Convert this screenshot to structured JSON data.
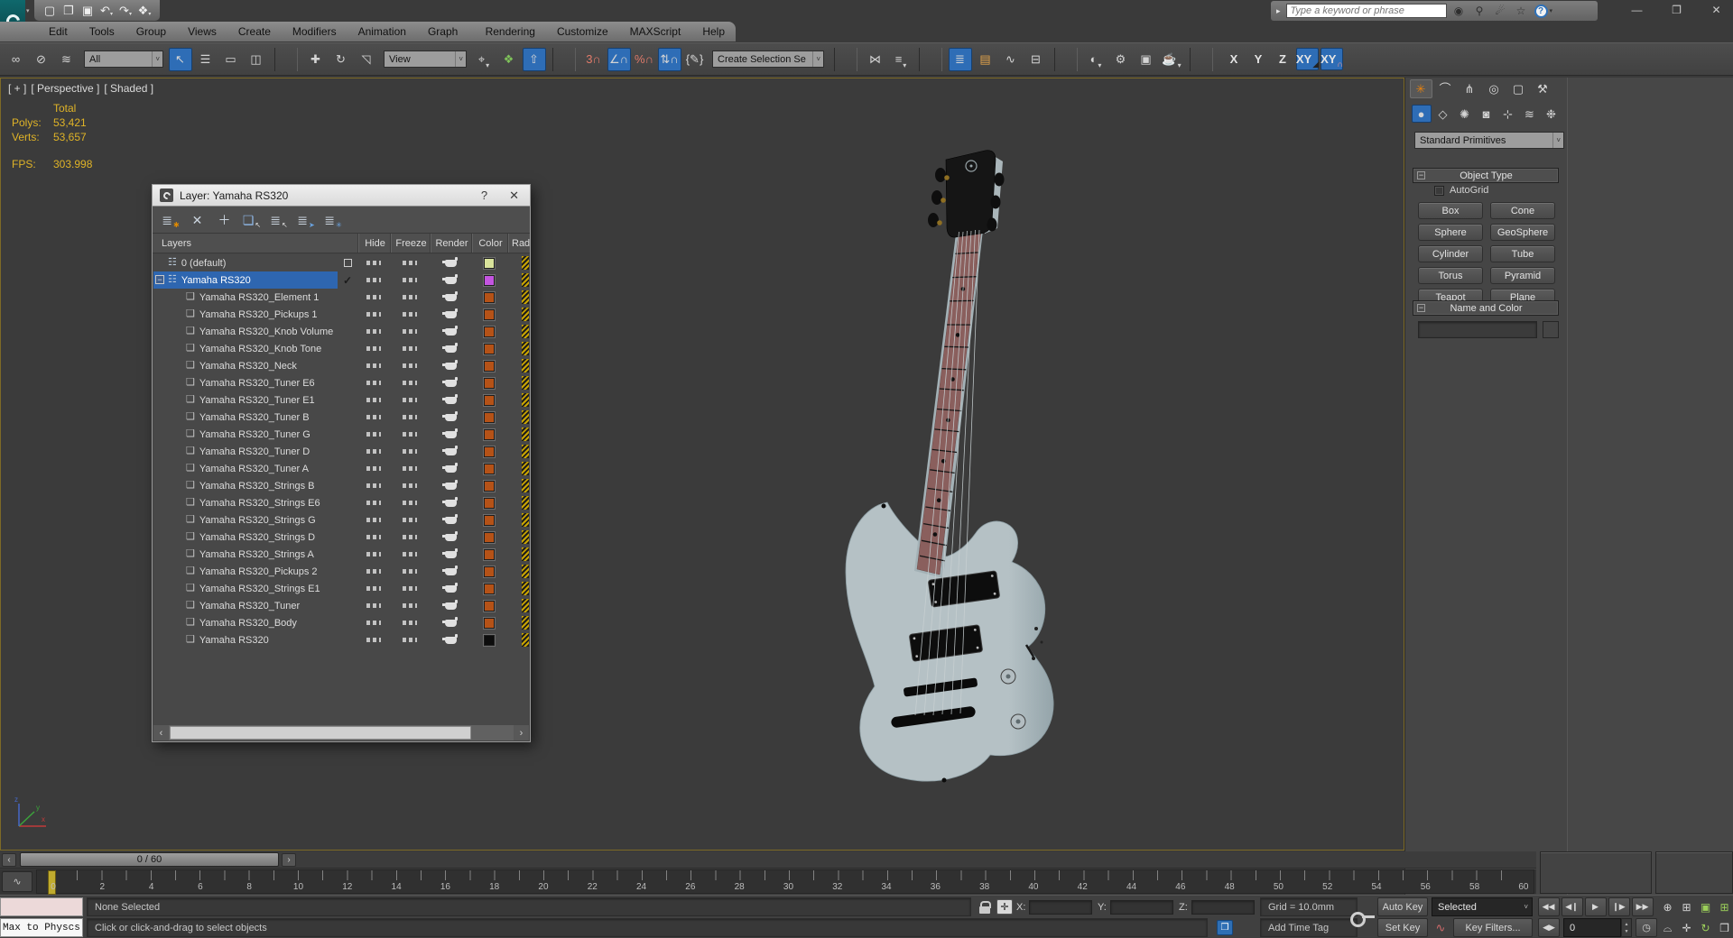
{
  "window": {
    "search_placeholder": "Type a keyword or phrase",
    "workspace_arrow": "▸",
    "qat": [
      {
        "g": "▢",
        "n": "new-scene-icon"
      },
      {
        "g": "❐",
        "n": "open-file-icon"
      },
      {
        "g": "▣",
        "n": "save-file-icon"
      },
      {
        "g": "↶",
        "n": "undo-icon",
        "drop": "▾"
      },
      {
        "g": "↷",
        "n": "redo-icon",
        "drop": "▾"
      },
      {
        "g": "❖",
        "n": "project-folder-icon",
        "drop": "▾"
      }
    ],
    "search_icons": [
      {
        "g": "◉",
        "n": "search-icon"
      },
      {
        "g": "⚲",
        "n": "sign-in-icon"
      },
      {
        "g": "☄",
        "n": "communication-center-icon"
      },
      {
        "g": "☆",
        "n": "favorites-icon"
      }
    ],
    "help_glyph": "?",
    "help_drop": "▾",
    "window_controls": [
      {
        "g": "—",
        "n": "minimize-button"
      },
      {
        "g": "❐",
        "n": "restore-button"
      },
      {
        "g": "✕",
        "n": "close-button"
      }
    ]
  },
  "menus": [
    "Edit",
    "Tools",
    "Group",
    "Views",
    "Create",
    "Modifiers",
    "Animation",
    "Graph Editors",
    "Rendering",
    "Customize",
    "MAXScript",
    "Help"
  ],
  "toolbar": {
    "seg_a": [
      {
        "g": "∞",
        "n": "select-and-link-icon"
      },
      {
        "g": "⊘",
        "n": "unlink-selection-icon"
      },
      {
        "g": "≋",
        "n": "bind-to-space-warp-icon"
      }
    ],
    "filter_dropdown": "All",
    "seg_b": [
      {
        "g": "↖",
        "n": "select-object-icon",
        "cls": "on"
      },
      {
        "g": "☰",
        "n": "select-by-name-icon"
      },
      {
        "g": "▭",
        "n": "rectangular-selection-region-icon"
      },
      {
        "g": "◫",
        "n": "window-crossing-icon"
      },
      {
        "cls": "sep",
        "n": "separator"
      },
      {
        "g": "✚",
        "n": "select-and-move-icon"
      },
      {
        "g": "↻",
        "n": "select-and-rotate-icon"
      },
      {
        "g": "◹",
        "n": "select-and-scale-icon"
      }
    ],
    "coord_dropdown": "View",
    "seg_c": [
      {
        "g": "⌖",
        "n": "use-pivot-point-center-icon",
        "drop": "▾"
      },
      {
        "g": "❖",
        "n": "select-and-manipulate-icon",
        "gc": "#7fc35a"
      },
      {
        "g": "⇧",
        "n": "keyboard-shortcut-override-icon",
        "cls": "on"
      },
      {
        "cls": "sep",
        "n": "separator"
      },
      {
        "g": "3∩",
        "n": "snaps-toggle-icon",
        "gc": "#e07a6a"
      },
      {
        "g": "∠∩",
        "n": "angle-snap-toggle-icon",
        "cls": "on"
      },
      {
        "g": "%∩",
        "n": "percent-snap-toggle-icon",
        "gc": "#e07a6a"
      },
      {
        "g": "⇅∩",
        "n": "spinner-snap-toggle-icon",
        "cls": "on"
      },
      {
        "g": "{✎}",
        "n": "edit-named-selection-sets-icon"
      }
    ],
    "selset_dropdown": "Create Selection Se",
    "seg_d": [
      {
        "cls": "sep",
        "n": "separator"
      },
      {
        "g": "⋈",
        "n": "mirror-icon"
      },
      {
        "g": "≡",
        "n": "align-icon",
        "drop": "▾"
      },
      {
        "cls": "sep",
        "n": "separator"
      },
      {
        "g": "≣",
        "n": "layer-manager-icon",
        "cls": "on"
      },
      {
        "g": "▤",
        "n": "scene-explorer-icon",
        "gc": "#e0a24a"
      },
      {
        "g": "∿",
        "n": "curve-editor-icon"
      },
      {
        "g": "⊟",
        "n": "schematic-view-icon"
      },
      {
        "cls": "sep",
        "n": "separator"
      },
      {
        "g": "◐",
        "n": "material-editor-icon",
        "drop": "▾"
      },
      {
        "g": "⚙",
        "n": "render-setup-icon"
      },
      {
        "g": "▣",
        "n": "rendered-frame-window-icon"
      },
      {
        "g": "☕",
        "n": "render-production-icon",
        "drop": "▾"
      },
      {
        "cls": "sep",
        "n": "separator"
      }
    ],
    "axis": [
      {
        "g": "X",
        "n": "restrict-x-button"
      },
      {
        "g": "Y",
        "n": "restrict-y-button"
      },
      {
        "g": "Z",
        "n": "restrict-z-button"
      },
      {
        "g": "XY",
        "n": "restrict-xy-plane-button",
        "cls": "on",
        "drop": "◢",
        "dc": "#222222"
      },
      {
        "g": "XY",
        "n": "snap-axis-constraint-button",
        "cls": "on",
        "drop": "∩",
        "dc": "#ff9a8a"
      }
    ]
  },
  "viewport": {
    "menu_general": "[ + ]",
    "menu_pov": "[ Perspective ]",
    "menu_shading": "[ Shaded ]",
    "stats": {
      "header": "Total",
      "polys_label": "Polys:",
      "polys": "53,421",
      "verts_label": "Verts:",
      "verts": "53,657",
      "fps_label": "FPS:",
      "fps": "303.998"
    }
  },
  "layer_dialog": {
    "title": "Layer: Yamaha RS320",
    "help_button": "?",
    "close_button": "✕",
    "toolbar": [
      {
        "g": "≣",
        "n": "create-new-layer-icon",
        "drop": "✱",
        "dc": "#e08a00"
      },
      {
        "g": "✕",
        "n": "delete-empty-layers-icon"
      },
      {
        "g": "＋",
        "n": "add-selection-to-layer-icon"
      },
      {
        "g": "❏",
        "n": "select-objects-in-layer-icon",
        "gc": "#8fb8e8",
        "drop": "↖",
        "dc": "#e6e6e6"
      },
      {
        "g": "≣",
        "n": "highlight-selected-objects-layers-icon",
        "drop": "↖",
        "dc": "#e6e6e6"
      },
      {
        "g": "≣",
        "n": "select-highlighted-layers-icon",
        "drop": "➤",
        "dc": "#6aa3e0"
      },
      {
        "g": "≣",
        "n": "set-current-layer-icon",
        "drop": "✳",
        "dc": "#6aa3e0"
      }
    ],
    "columns": [
      "Layers",
      "Hide",
      "Freeze",
      "Render",
      "Color",
      "Rad"
    ],
    "rows": [
      {
        "label": "0 (default)",
        "icon": "lyr",
        "color": "#d9e39b",
        "cls": "def"
      },
      {
        "label": "Yamaha RS320",
        "icon": "lyr",
        "color": "#c455e0",
        "cls": "sel"
      },
      {
        "label": "Yamaha RS320_Element 1",
        "icon": "obj",
        "color": "#b55217",
        "cls": "child"
      },
      {
        "label": "Yamaha RS320_Pickups 1",
        "icon": "obj",
        "color": "#b55217",
        "cls": "child"
      },
      {
        "label": "Yamaha RS320_Knob Volume",
        "icon": "obj",
        "color": "#b55217",
        "cls": "child"
      },
      {
        "label": "Yamaha RS320_Knob Tone",
        "icon": "obj",
        "color": "#b55217",
        "cls": "child"
      },
      {
        "label": "Yamaha RS320_Neck",
        "icon": "obj",
        "color": "#b55217",
        "cls": "child"
      },
      {
        "label": "Yamaha RS320_Tuner E6",
        "icon": "obj",
        "color": "#b55217",
        "cls": "child"
      },
      {
        "label": "Yamaha RS320_Tuner E1",
        "icon": "obj",
        "color": "#b55217",
        "cls": "child"
      },
      {
        "label": "Yamaha RS320_Tuner B",
        "icon": "obj",
        "color": "#b55217",
        "cls": "child"
      },
      {
        "label": "Yamaha RS320_Tuner G",
        "icon": "obj",
        "color": "#b55217",
        "cls": "child"
      },
      {
        "label": "Yamaha RS320_Tuner D",
        "icon": "obj",
        "color": "#b55217",
        "cls": "child"
      },
      {
        "label": "Yamaha RS320_Tuner A",
        "icon": "obj",
        "color": "#b55217",
        "cls": "child"
      },
      {
        "label": "Yamaha RS320_Strings B",
        "icon": "obj",
        "color": "#b55217",
        "cls": "child"
      },
      {
        "label": "Yamaha RS320_Strings E6",
        "icon": "obj",
        "color": "#b55217",
        "cls": "child"
      },
      {
        "label": "Yamaha RS320_Strings G",
        "icon": "obj",
        "color": "#b55217",
        "cls": "child"
      },
      {
        "label": "Yamaha RS320_Strings D",
        "icon": "obj",
        "color": "#b55217",
        "cls": "child"
      },
      {
        "label": "Yamaha RS320_Strings A",
        "icon": "obj",
        "color": "#b55217",
        "cls": "child"
      },
      {
        "label": "Yamaha RS320_Pickups 2",
        "icon": "obj",
        "color": "#b55217",
        "cls": "child"
      },
      {
        "label": "Yamaha RS320_Strings E1",
        "icon": "obj",
        "color": "#b55217",
        "cls": "child"
      },
      {
        "label": "Yamaha RS320_Tuner",
        "icon": "obj",
        "color": "#b55217",
        "cls": "child"
      },
      {
        "label": "Yamaha RS320_Body",
        "icon": "obj",
        "color": "#b55217",
        "cls": "child"
      },
      {
        "label": "Yamaha RS320",
        "icon": "obj",
        "color": "#0d0d0d",
        "cls": "child"
      }
    ]
  },
  "command_panel": {
    "tabs": [
      {
        "g": "✳",
        "n": "tab-create",
        "cls": "on",
        "gc": "#e8820e"
      },
      {
        "g": "⌒",
        "n": "tab-modify"
      },
      {
        "g": "⋔",
        "n": "tab-hierarchy"
      },
      {
        "g": "◎",
        "n": "tab-motion"
      },
      {
        "g": "▢",
        "n": "tab-display"
      },
      {
        "g": "⚒",
        "n": "tab-utilities"
      }
    ],
    "categories": [
      {
        "g": "●",
        "n": "category-geometry",
        "cls": "on"
      },
      {
        "g": "◇",
        "n": "category-shapes"
      },
      {
        "g": "✺",
        "n": "category-lights"
      },
      {
        "g": "◙",
        "n": "category-cameras"
      },
      {
        "g": "⊹",
        "n": "category-helpers"
      },
      {
        "g": "≋",
        "n": "category-space-warps"
      },
      {
        "g": "❉",
        "n": "category-systems"
      }
    ],
    "object_class_dropdown": "Standard Primitives",
    "rollout_object_type": "Object Type",
    "autogrid_label": "AutoGrid",
    "object_buttons": [
      "Box",
      "Cone",
      "Sphere",
      "GeoSphere",
      "Cylinder",
      "Tube",
      "Torus",
      "Pyramid",
      "Teapot",
      "Plane"
    ],
    "rollout_name_color": "Name and Color",
    "object_color": "#cf8a33"
  },
  "timeline": {
    "current_frame_display": "0 / 60",
    "prev_arrow": "‹",
    "next_arrow": "›",
    "curve_editor_glyph": "∿",
    "tick_labels": [
      "0",
      "2",
      "4",
      "6",
      "8",
      "10",
      "12",
      "14",
      "16",
      "18",
      "20",
      "22",
      "24",
      "26",
      "28",
      "30",
      "32",
      "34",
      "36",
      "38",
      "40",
      "42",
      "44",
      "46",
      "48",
      "50",
      "52",
      "54",
      "56",
      "58",
      "60"
    ]
  },
  "status": {
    "script_line": "Max to Physcs",
    "selection_status": "None Selected",
    "prompt": "Click or click-and-drag to select objects",
    "x_label": "X:",
    "y_label": "Y:",
    "z_label": "Z:",
    "grid_display": "Grid = 10.0mm",
    "add_time_tag": "Add Time Tag",
    "auto_key": "Auto Key",
    "set_key": "Set Key",
    "selection_set": "Selected",
    "key_filters": "Key Filters...",
    "frame_field": "0",
    "key_mode": "◀▶",
    "time_config": "◷",
    "playback": [
      {
        "g": "◀◀",
        "n": "go-to-start-icon"
      },
      {
        "g": "◀❙",
        "n": "previous-frame-icon"
      },
      {
        "g": "▶",
        "n": "play-animation-icon"
      },
      {
        "g": "❙▶",
        "n": "next-frame-icon"
      },
      {
        "g": "▶▶",
        "n": "go-to-end-icon"
      }
    ],
    "nav_top": [
      {
        "g": "⊕",
        "n": "zoom-icon"
      },
      {
        "g": "⊞",
        "n": "zoom-all-icon"
      },
      {
        "g": "▣",
        "n": "zoom-extents-icon",
        "gc": "#9ccf5a"
      },
      {
        "g": "⊞",
        "n": "zoom-extents-all-icon",
        "gc": "#9ccf5a"
      }
    ],
    "nav_bottom": [
      {
        "g": "⌓",
        "n": "field-of-view-icon"
      },
      {
        "g": "✛",
        "n": "pan-view-icon"
      },
      {
        "g": "↻",
        "n": "orbit-icon",
        "gc": "#9ccf5a"
      },
      {
        "g": "❒",
        "n": "maximize-viewport-toggle-icon"
      }
    ]
  },
  "colors": {
    "selection_highlight": "#2e66b0",
    "active_button_blue": "#2e6db6",
    "stats_yellow": "#dfb327",
    "viewport_bg": "#3b3b3b",
    "guitar_body": "#b5c1c5",
    "fretboard": "#8a5f5d"
  }
}
